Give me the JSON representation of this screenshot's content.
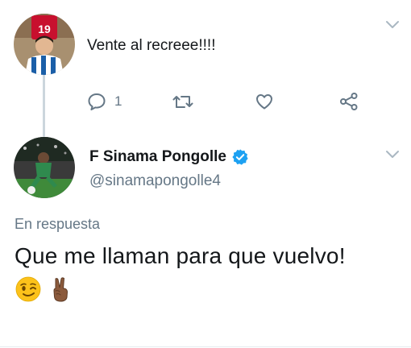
{
  "colors": {
    "verified": "#1da1f2",
    "text": "#14171a",
    "muted": "#657786",
    "icon": "#657786"
  },
  "reply_tweet": {
    "jersey_number": "19",
    "text": "Vente al recreee!!!!",
    "actions": {
      "reply_count": "1"
    }
  },
  "main_tweet": {
    "display_name": "F Sinama Pongolle",
    "handle": "@sinamapongolle4",
    "reply_label": "En respuesta",
    "text": "Que me llaman para que vuelvo!",
    "emojis": [
      "winking-face",
      "victory-hand"
    ]
  }
}
